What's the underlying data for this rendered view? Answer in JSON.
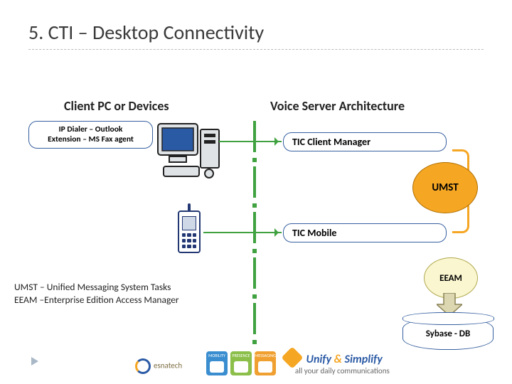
{
  "title": "5. CTI – Desktop Connectivity",
  "columns": {
    "left": "Client PC or Devices",
    "right": "Voice Server Architecture"
  },
  "client_box": {
    "line1": "IP Dialer – Outlook",
    "line2": "Extension – MS Fax  agent"
  },
  "server_boxes": {
    "client_manager": "TIC Client Manager",
    "mobile": "TIC Mobile"
  },
  "nodes": {
    "umst": "UMST",
    "eeam": "EEAM",
    "db": "Sybase - DB"
  },
  "glossary": {
    "l1": "UMST – Unified Messaging System Tasks",
    "l2": "EEAM –Enterprise Edition Access Manager"
  },
  "footer": {
    "esna": "esnatech",
    "icon1": "MOBILITY",
    "icon2": "PRESENCE",
    "icon3": "MESSAGING",
    "unify_big": "Unify & Simplify",
    "unify_sub": "all your daily communications"
  },
  "colors": {
    "accent_green": "#3fa13f",
    "accent_orange": "#f5a623",
    "accent_blue": "#365f9f"
  }
}
